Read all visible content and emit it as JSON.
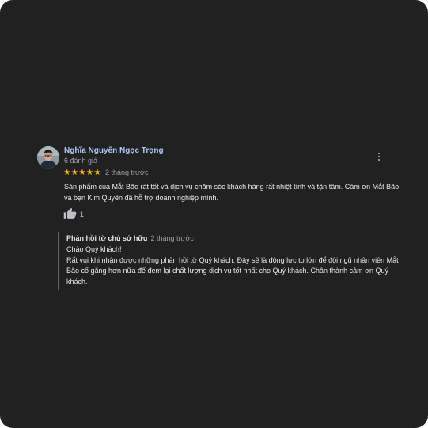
{
  "colors": {
    "background": "#212121",
    "reviewer_name": "#aecbfa",
    "star": "#fbbc04",
    "text": "#e8eaed",
    "muted": "#9aa0a6"
  },
  "review": {
    "reviewer_name": "Nghĩa Nguyễn Ngọc Trọng",
    "review_count": "6 đánh giá",
    "rating": 5,
    "rating_max": 5,
    "stars": [
      "★",
      "★",
      "★",
      "★",
      "★"
    ],
    "time": "2 tháng trước",
    "text": "Sản phẩm của Mắt Bão rất tốt và dịch vụ chăm sóc khách hàng rất nhiệt tình và tận tâm. Cảm ơn Mắt Bão và bạn Kim Quyên đã hỗ trợ doanh nghiệp mình.",
    "likes": "1",
    "icons": {
      "avatar": "avatar",
      "more": "more-vert-icon",
      "like": "thumb-up-icon"
    }
  },
  "owner_reply": {
    "author": "Phản hồi từ chủ sở hữu",
    "time": "2 tháng trước",
    "greeting": "Chào Quý khách!",
    "body": "Rất vui khi nhận được những phản hồi từ Quý khách. Đây sẽ là động lực to lớn để đội ngũ nhân viên Mắt Bão cố gắng hơn nữa để đem lại chất lượng dịch vụ tốt nhất cho Quý khách. Chân thành cảm ơn Quý khách."
  }
}
